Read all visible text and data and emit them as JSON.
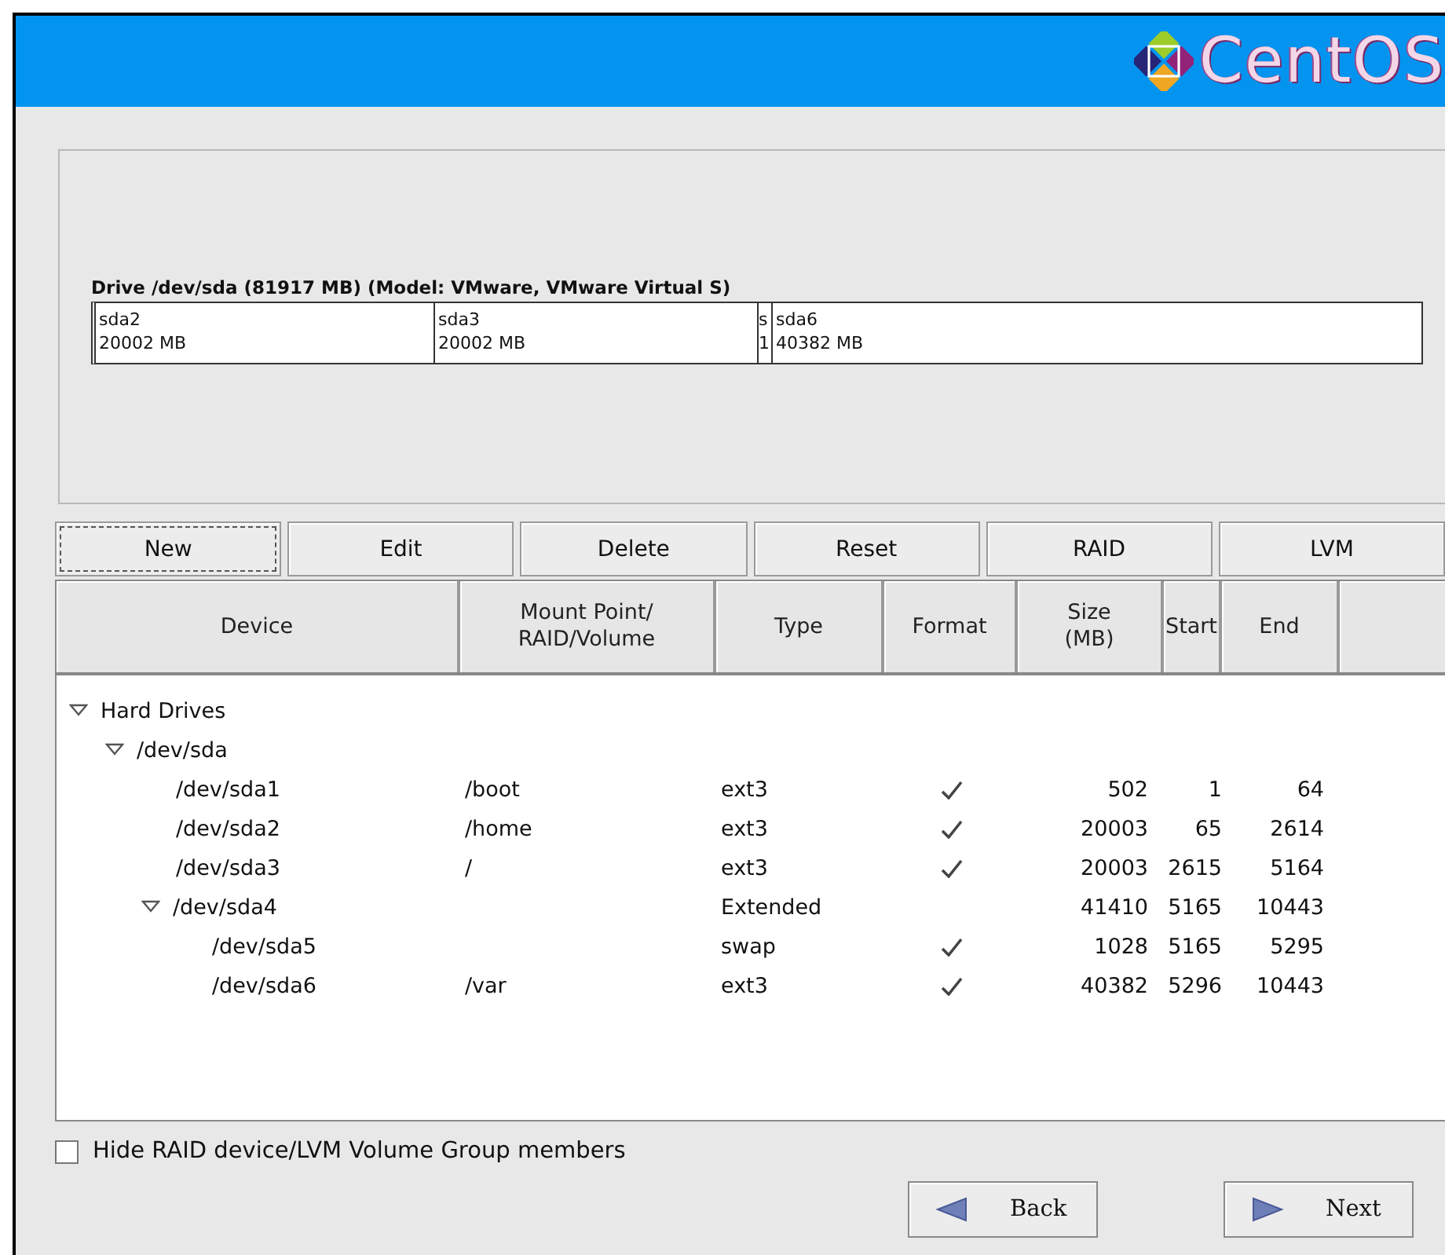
{
  "header": {
    "logo_text": "CentOS"
  },
  "drive": {
    "title": "Drive /dev/sda (81917 MB) (Model: VMware, VMware Virtual S)",
    "segments": [
      {
        "name": "sda2",
        "size": "20002 MB"
      },
      {
        "name": "sda3",
        "size": "20002 MB"
      },
      {
        "name": "s",
        "size": "1"
      },
      {
        "name": "sda6",
        "size": "40382 MB"
      }
    ]
  },
  "toolbar": {
    "buttons": [
      {
        "label": "New",
        "focused": true
      },
      {
        "label": "Edit",
        "focused": false
      },
      {
        "label": "Delete",
        "focused": false
      },
      {
        "label": "Reset",
        "focused": false
      },
      {
        "label": "RAID",
        "focused": false
      },
      {
        "label": "LVM",
        "focused": false
      }
    ]
  },
  "table": {
    "columns": [
      "Device",
      "Mount Point/\nRAID/Volume",
      "Type",
      "Format",
      "Size\n(MB)",
      "Start",
      "End"
    ],
    "rows": [
      {
        "device": "Hard Drives",
        "expanded": true,
        "children": [
          {
            "device": "/dev/sda",
            "expanded": true,
            "children": [
              {
                "device": "/dev/sda1",
                "mount": "/boot",
                "type": "ext3",
                "format": true,
                "size": "502",
                "start": "1",
                "end": "64"
              },
              {
                "device": "/dev/sda2",
                "mount": "/home",
                "type": "ext3",
                "format": true,
                "size": "20003",
                "start": "65",
                "end": "2614"
              },
              {
                "device": "/dev/sda3",
                "mount": "/",
                "type": "ext3",
                "format": true,
                "size": "20003",
                "start": "2615",
                "end": "5164"
              },
              {
                "device": "/dev/sda4",
                "type": "Extended",
                "format": false,
                "size": "41410",
                "start": "5165",
                "end": "10443",
                "expanded": true,
                "children": [
                  {
                    "device": "/dev/sda5",
                    "type": "swap",
                    "format": true,
                    "size": "1028",
                    "start": "5165",
                    "end": "5295"
                  },
                  {
                    "device": "/dev/sda6",
                    "mount": "/var",
                    "type": "ext3",
                    "format": true,
                    "size": "40382",
                    "start": "5296",
                    "end": "10443"
                  }
                ]
              }
            ]
          }
        ]
      }
    ]
  },
  "hide_members": {
    "label": "Hide RAID device/LVM Volume Group members",
    "checked": false
  },
  "nav": [
    {
      "label": "Back",
      "kind": "back"
    },
    {
      "label": "Next",
      "kind": "next"
    }
  ]
}
